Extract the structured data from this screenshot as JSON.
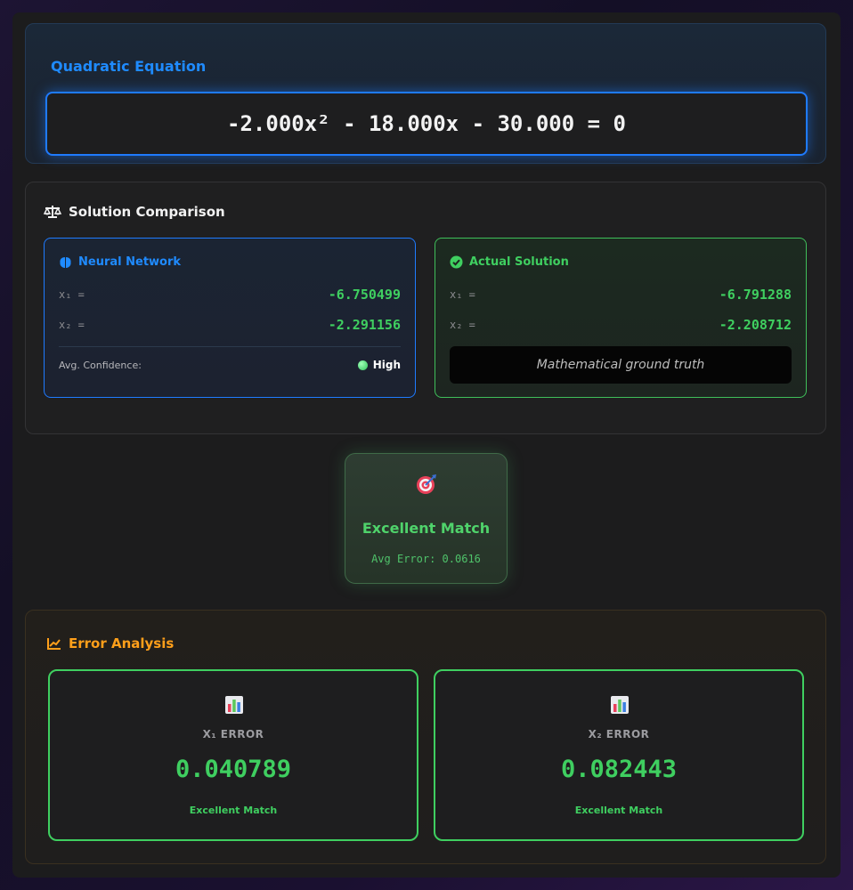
{
  "equation": {
    "title": "Quadratic Equation",
    "expression": "-2.000x² - 18.000x - 30.000 = 0"
  },
  "comparison": {
    "title": "Solution Comparison",
    "title_icon": "balance-scale-icon",
    "neural": {
      "title": "Neural Network",
      "icon": "brain-icon",
      "x1_label": "x₁ =",
      "x1_value": "-6.750499",
      "x2_label": "x₂ =",
      "x2_value": "-2.291156",
      "confidence_label": "Avg. Confidence:",
      "confidence_value": "High"
    },
    "actual": {
      "title": "Actual Solution",
      "icon": "check-circle-icon",
      "x1_label": "x₁ =",
      "x1_value": "-6.791288",
      "x2_label": "x₂ =",
      "x2_value": "-2.208712",
      "note": "Mathematical ground truth"
    }
  },
  "match": {
    "icon": "target-icon",
    "title": "Excellent Match",
    "avg_error": "Avg Error: 0.0616"
  },
  "error_analysis": {
    "title": "Error Analysis",
    "title_icon": "line-chart-icon",
    "x1": {
      "icon": "bar-chart-icon",
      "label": "X₁ ERROR",
      "value": "0.040789",
      "status": "Excellent Match"
    },
    "x2": {
      "icon": "bar-chart-icon",
      "label": "X₂ ERROR",
      "value": "0.082443",
      "status": "Excellent Match"
    }
  },
  "colors": {
    "accent_blue": "#1f7bff",
    "success_green": "#3fcf60",
    "warning_orange": "#ff9f1a"
  }
}
